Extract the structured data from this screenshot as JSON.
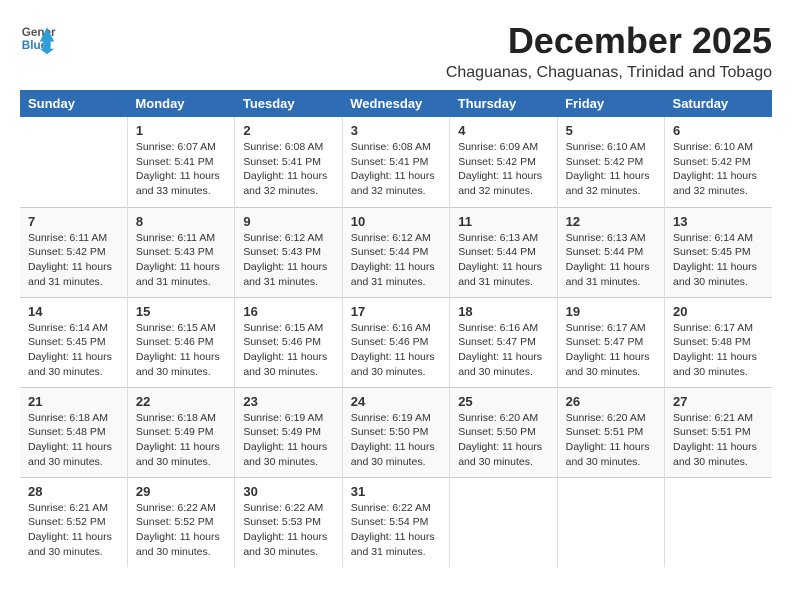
{
  "header": {
    "logo_line1": "General",
    "logo_line2": "Blue",
    "month": "December 2025",
    "location": "Chaguanas, Chaguanas, Trinidad and Tobago"
  },
  "days_of_week": [
    "Sunday",
    "Monday",
    "Tuesday",
    "Wednesday",
    "Thursday",
    "Friday",
    "Saturday"
  ],
  "weeks": [
    [
      {
        "day": "",
        "info": ""
      },
      {
        "day": "1",
        "info": "Sunrise: 6:07 AM\nSunset: 5:41 PM\nDaylight: 11 hours\nand 33 minutes."
      },
      {
        "day": "2",
        "info": "Sunrise: 6:08 AM\nSunset: 5:41 PM\nDaylight: 11 hours\nand 32 minutes."
      },
      {
        "day": "3",
        "info": "Sunrise: 6:08 AM\nSunset: 5:41 PM\nDaylight: 11 hours\nand 32 minutes."
      },
      {
        "day": "4",
        "info": "Sunrise: 6:09 AM\nSunset: 5:42 PM\nDaylight: 11 hours\nand 32 minutes."
      },
      {
        "day": "5",
        "info": "Sunrise: 6:10 AM\nSunset: 5:42 PM\nDaylight: 11 hours\nand 32 minutes."
      },
      {
        "day": "6",
        "info": "Sunrise: 6:10 AM\nSunset: 5:42 PM\nDaylight: 11 hours\nand 32 minutes."
      }
    ],
    [
      {
        "day": "7",
        "info": "Sunrise: 6:11 AM\nSunset: 5:42 PM\nDaylight: 11 hours\nand 31 minutes."
      },
      {
        "day": "8",
        "info": "Sunrise: 6:11 AM\nSunset: 5:43 PM\nDaylight: 11 hours\nand 31 minutes."
      },
      {
        "day": "9",
        "info": "Sunrise: 6:12 AM\nSunset: 5:43 PM\nDaylight: 11 hours\nand 31 minutes."
      },
      {
        "day": "10",
        "info": "Sunrise: 6:12 AM\nSunset: 5:44 PM\nDaylight: 11 hours\nand 31 minutes."
      },
      {
        "day": "11",
        "info": "Sunrise: 6:13 AM\nSunset: 5:44 PM\nDaylight: 11 hours\nand 31 minutes."
      },
      {
        "day": "12",
        "info": "Sunrise: 6:13 AM\nSunset: 5:44 PM\nDaylight: 11 hours\nand 31 minutes."
      },
      {
        "day": "13",
        "info": "Sunrise: 6:14 AM\nSunset: 5:45 PM\nDaylight: 11 hours\nand 30 minutes."
      }
    ],
    [
      {
        "day": "14",
        "info": "Sunrise: 6:14 AM\nSunset: 5:45 PM\nDaylight: 11 hours\nand 30 minutes."
      },
      {
        "day": "15",
        "info": "Sunrise: 6:15 AM\nSunset: 5:46 PM\nDaylight: 11 hours\nand 30 minutes."
      },
      {
        "day": "16",
        "info": "Sunrise: 6:15 AM\nSunset: 5:46 PM\nDaylight: 11 hours\nand 30 minutes."
      },
      {
        "day": "17",
        "info": "Sunrise: 6:16 AM\nSunset: 5:46 PM\nDaylight: 11 hours\nand 30 minutes."
      },
      {
        "day": "18",
        "info": "Sunrise: 6:16 AM\nSunset: 5:47 PM\nDaylight: 11 hours\nand 30 minutes."
      },
      {
        "day": "19",
        "info": "Sunrise: 6:17 AM\nSunset: 5:47 PM\nDaylight: 11 hours\nand 30 minutes."
      },
      {
        "day": "20",
        "info": "Sunrise: 6:17 AM\nSunset: 5:48 PM\nDaylight: 11 hours\nand 30 minutes."
      }
    ],
    [
      {
        "day": "21",
        "info": "Sunrise: 6:18 AM\nSunset: 5:48 PM\nDaylight: 11 hours\nand 30 minutes."
      },
      {
        "day": "22",
        "info": "Sunrise: 6:18 AM\nSunset: 5:49 PM\nDaylight: 11 hours\nand 30 minutes."
      },
      {
        "day": "23",
        "info": "Sunrise: 6:19 AM\nSunset: 5:49 PM\nDaylight: 11 hours\nand 30 minutes."
      },
      {
        "day": "24",
        "info": "Sunrise: 6:19 AM\nSunset: 5:50 PM\nDaylight: 11 hours\nand 30 minutes."
      },
      {
        "day": "25",
        "info": "Sunrise: 6:20 AM\nSunset: 5:50 PM\nDaylight: 11 hours\nand 30 minutes."
      },
      {
        "day": "26",
        "info": "Sunrise: 6:20 AM\nSunset: 5:51 PM\nDaylight: 11 hours\nand 30 minutes."
      },
      {
        "day": "27",
        "info": "Sunrise: 6:21 AM\nSunset: 5:51 PM\nDaylight: 11 hours\nand 30 minutes."
      }
    ],
    [
      {
        "day": "28",
        "info": "Sunrise: 6:21 AM\nSunset: 5:52 PM\nDaylight: 11 hours\nand 30 minutes."
      },
      {
        "day": "29",
        "info": "Sunrise: 6:22 AM\nSunset: 5:52 PM\nDaylight: 11 hours\nand 30 minutes."
      },
      {
        "day": "30",
        "info": "Sunrise: 6:22 AM\nSunset: 5:53 PM\nDaylight: 11 hours\nand 30 minutes."
      },
      {
        "day": "31",
        "info": "Sunrise: 6:22 AM\nSunset: 5:54 PM\nDaylight: 11 hours\nand 31 minutes."
      },
      {
        "day": "",
        "info": ""
      },
      {
        "day": "",
        "info": ""
      },
      {
        "day": "",
        "info": ""
      }
    ]
  ]
}
